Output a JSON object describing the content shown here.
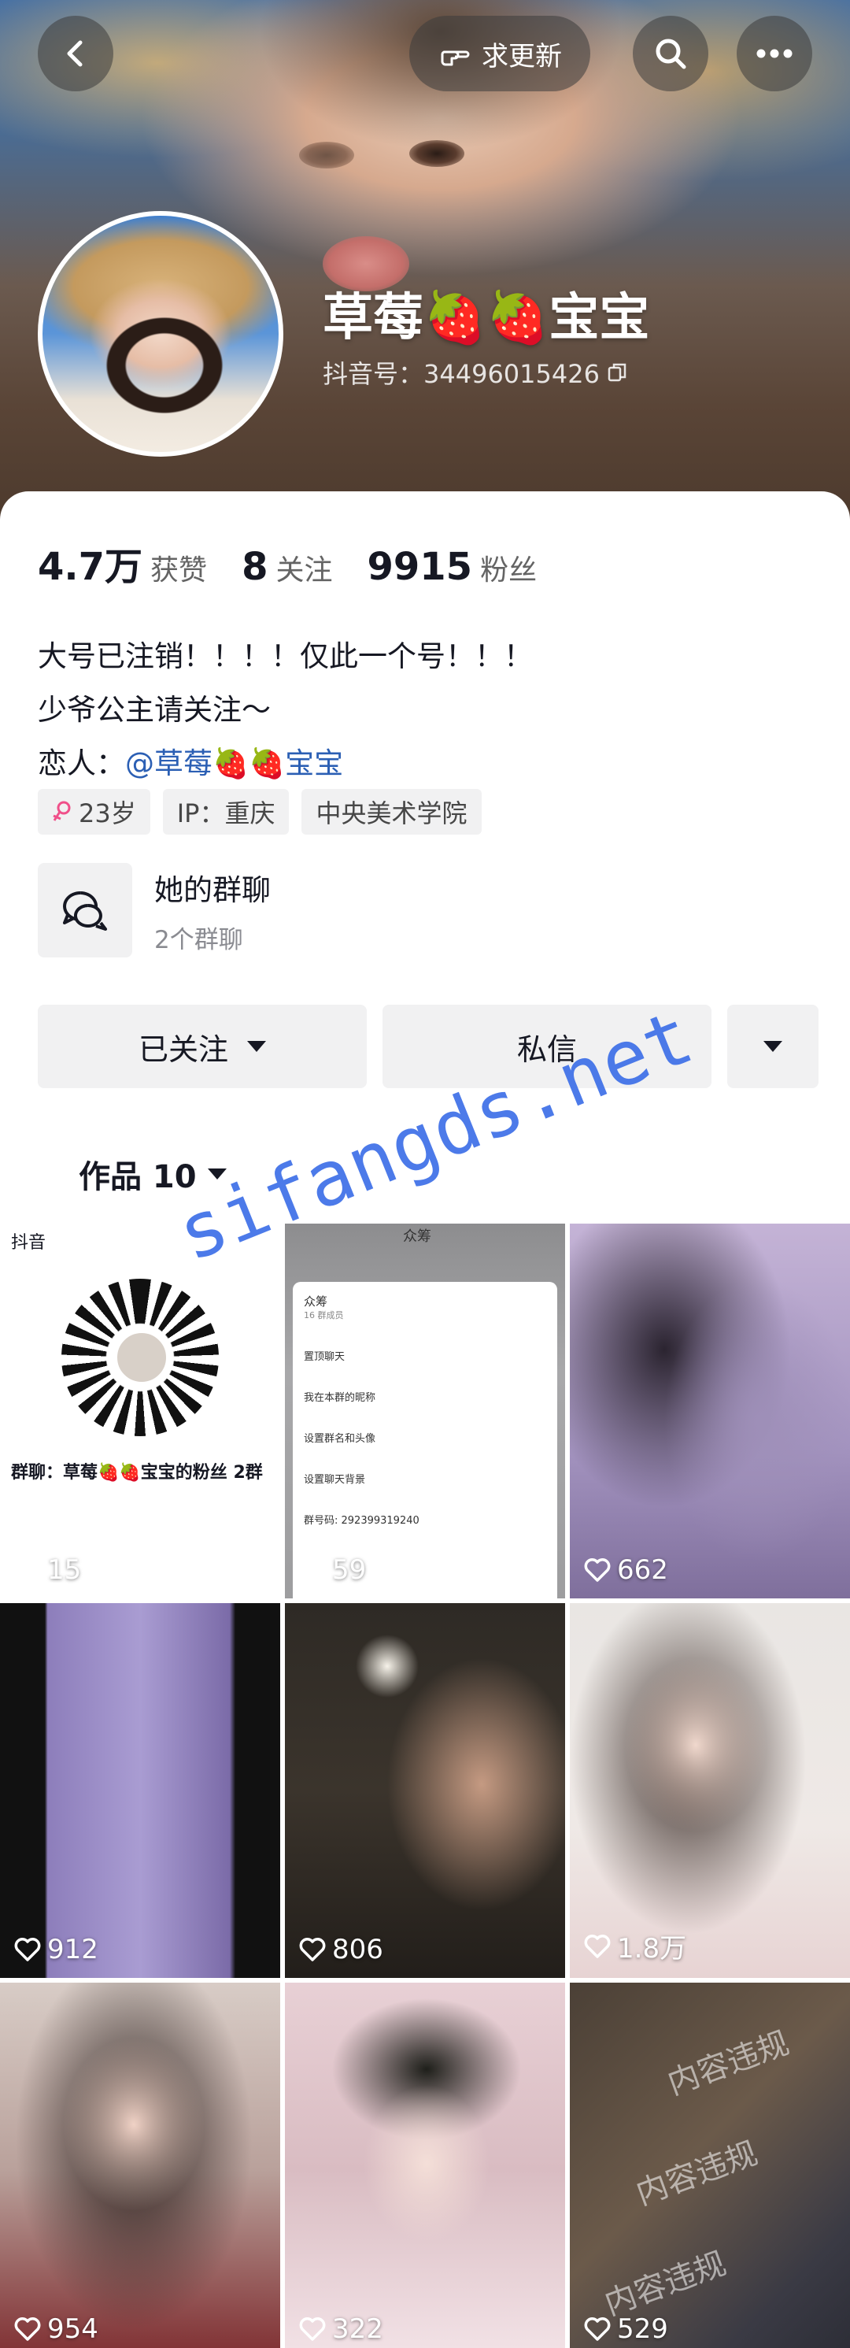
{
  "header": {
    "back_icon": "chevron-left-icon",
    "update_button": "求更新",
    "update_icon": "hand-point-icon",
    "search_icon": "search-icon",
    "more_icon": "more-icon",
    "nickname": "草莓🍓🍓宝宝",
    "douyin_id": "抖音号：34496015426",
    "copy_icon": "copy-icon"
  },
  "stats": [
    {
      "value": "4.7万",
      "label": "获赞"
    },
    {
      "value": "8",
      "label": "关注"
    },
    {
      "value": "9915",
      "label": "粉丝"
    }
  ],
  "bio": {
    "line1": "大号已注销！！！！仅此一个号！！！",
    "line2": "少爷公主请关注～",
    "line3_prefix": "恋人：",
    "line3_mention": "@草莓🍓🍓宝宝"
  },
  "tags": {
    "age": "23岁",
    "ip": "IP：重庆",
    "school": "中央美术学院"
  },
  "group_chat": {
    "title": "她的群聊",
    "subtitle": "2个群聊"
  },
  "actions": {
    "followed": "已关注",
    "message": "私信"
  },
  "works_tab": "作品 10",
  "watermark": "sifangds.net",
  "grid": {
    "tile1": {
      "logo": "抖音",
      "title": "群聊：草莓🍓🍓宝宝的粉丝 2群",
      "likes": "15"
    },
    "tile2": {
      "header": "众筹",
      "group_name": "众筹",
      "group_count": "16 群成员",
      "rows": [
        "置顶聊天",
        "我在本群的昵称",
        "设置群名和头像",
        "设置聊天背景",
        "群号码: 292399319240"
      ],
      "likes": "59"
    },
    "tile3": {
      "likes": "662"
    },
    "tile4": {
      "likes": "912"
    },
    "tile5": {
      "likes": "806"
    },
    "tile6": {
      "likes": "1.8万"
    },
    "tile7": {
      "likes": "954"
    },
    "tile8": {
      "likes": "322"
    },
    "tile9": {
      "likes": "529",
      "violation": "内容违规"
    }
  },
  "colors": {
    "mention": "#2b5fb4",
    "tag_bg": "#f1f1f2",
    "watermark": "#3d6fe8"
  }
}
